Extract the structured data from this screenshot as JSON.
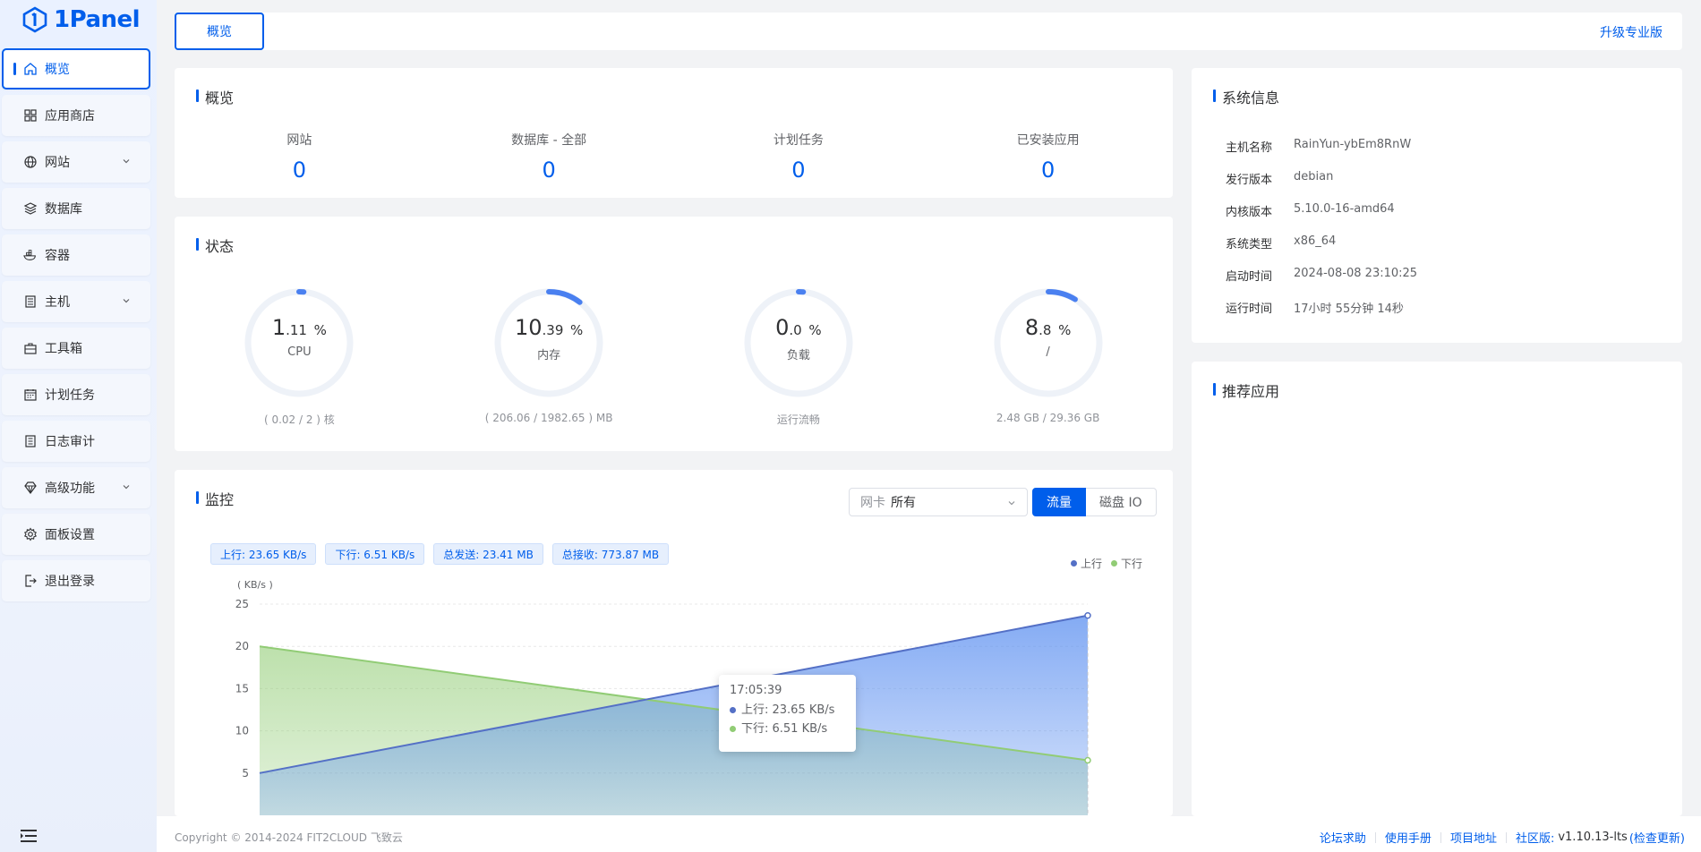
{
  "app": {
    "name": "1Panel"
  },
  "sidebar": {
    "items": [
      {
        "label": "概览",
        "icon": "home-icon",
        "active": true,
        "has_submenu": false
      },
      {
        "label": "应用商店",
        "icon": "grid-icon",
        "active": false,
        "has_submenu": false
      },
      {
        "label": "网站",
        "icon": "globe-icon",
        "active": false,
        "has_submenu": true
      },
      {
        "label": "数据库",
        "icon": "layers-icon",
        "active": false,
        "has_submenu": false
      },
      {
        "label": "容器",
        "icon": "docker-icon",
        "active": false,
        "has_submenu": false
      },
      {
        "label": "主机",
        "icon": "server-icon",
        "active": false,
        "has_submenu": true
      },
      {
        "label": "工具箱",
        "icon": "toolbox-icon",
        "active": false,
        "has_submenu": false
      },
      {
        "label": "计划任务",
        "icon": "calendar-icon",
        "active": false,
        "has_submenu": false
      },
      {
        "label": "日志审计",
        "icon": "log-icon",
        "active": false,
        "has_submenu": false
      },
      {
        "label": "高级功能",
        "icon": "diamond-icon",
        "active": false,
        "has_submenu": true
      },
      {
        "label": "面板设置",
        "icon": "gear-icon",
        "active": false,
        "has_submenu": false
      },
      {
        "label": "退出登录",
        "icon": "logout-icon",
        "active": false,
        "has_submenu": false
      }
    ]
  },
  "topbar": {
    "tab_label": "概览",
    "upgrade_label": "升级专业版"
  },
  "overview": {
    "title": "概览",
    "stats": [
      {
        "label": "网站",
        "value": "0"
      },
      {
        "label": "数据库 - 全部",
        "value": "0"
      },
      {
        "label": "计划任务",
        "value": "0"
      },
      {
        "label": "已安装应用",
        "value": "0"
      }
    ]
  },
  "status": {
    "title": "状态",
    "gauges": [
      {
        "int": "1",
        "dec": ".11",
        "unit": "%",
        "name": "CPU",
        "foot": "( 0.02 / 2 ) 核",
        "percent": 1.11
      },
      {
        "int": "10",
        "dec": ".39",
        "unit": "%",
        "name": "内存",
        "foot": "( 206.06 / 1982.65 ) MB",
        "percent": 10.39
      },
      {
        "int": "0",
        "dec": ".0",
        "unit": "%",
        "name": "负载",
        "foot": "运行流畅",
        "percent": 0
      },
      {
        "int": "8",
        "dec": ".8",
        "unit": "%",
        "name": "/",
        "foot": "2.48 GB / 29.36 GB",
        "percent": 8.8
      }
    ]
  },
  "monitor": {
    "title": "监控",
    "nic_prefix": "网卡",
    "nic_value": "所有",
    "btn_traffic": "流量",
    "btn_disk": "磁盘 IO",
    "tags": [
      "上行: 23.65 KB/s",
      "下行: 6.51 KB/s",
      "总发送: 23.41 MB",
      "总接收: 773.87 MB"
    ],
    "legend": [
      {
        "name": "上行",
        "color": "#5470c6"
      },
      {
        "name": "下行",
        "color": "#91cc75"
      }
    ],
    "tooltip": {
      "time": "17:05:39",
      "up": "上行: 23.65 KB/s",
      "down": "下行: 6.51 KB/s"
    }
  },
  "chart_data": {
    "type": "area",
    "ylabel": "( KB/s )",
    "yticks": [
      5,
      10,
      15,
      20,
      25
    ],
    "ylim": [
      0,
      25
    ],
    "series": [
      {
        "name": "上行",
        "color": "#5470c6",
        "values": [
          5,
          23.65
        ]
      },
      {
        "name": "下行",
        "color": "#91cc75",
        "values": [
          20,
          6.51
        ]
      }
    ],
    "x": [
      "",
      "17:05:39"
    ]
  },
  "sysinfo": {
    "title": "系统信息",
    "rows": [
      {
        "key": "主机名称",
        "value": "RainYun-ybEm8RnW"
      },
      {
        "key": "发行版本",
        "value": "debian"
      },
      {
        "key": "内核版本",
        "value": "5.10.0-16-amd64"
      },
      {
        "key": "系统类型",
        "value": "x86_64"
      },
      {
        "key": "启动时间",
        "value": "2024-08-08 23:10:25"
      },
      {
        "key": "运行时间",
        "value": "17小时 55分钟 14秒"
      }
    ]
  },
  "recommend": {
    "title": "推荐应用"
  },
  "footer": {
    "copyright": "Copyright © 2014-2024 FIT2CLOUD 飞致云",
    "links": [
      "论坛求助",
      "使用手册",
      "项目地址"
    ],
    "edition": "社区版:",
    "version": "v1.10.13-lts",
    "check_update": "(检查更新)"
  }
}
